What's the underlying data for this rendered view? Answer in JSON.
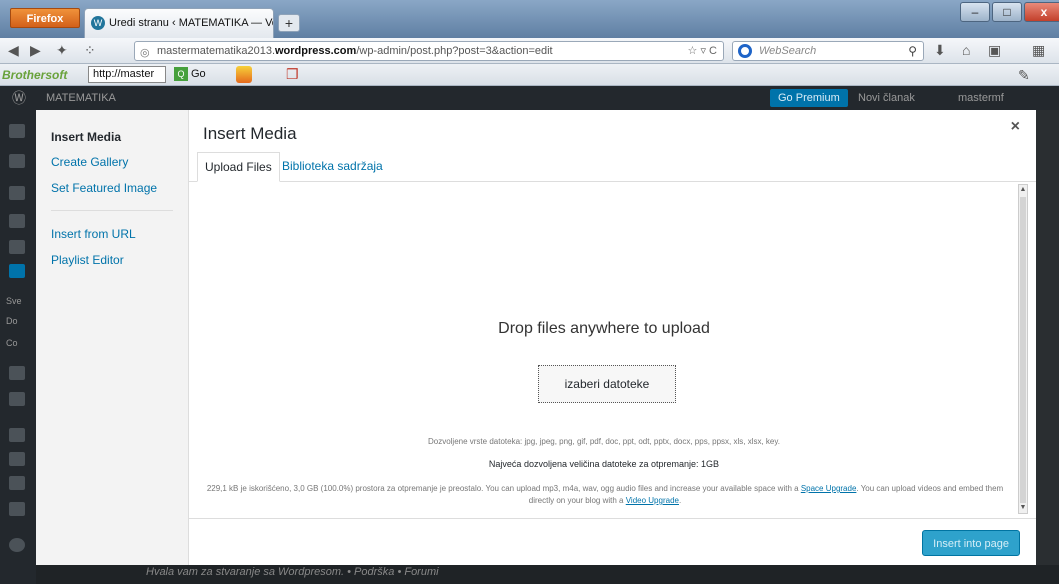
{
  "browser": {
    "app_button": "Firefox",
    "tab_title": "Uredi stranu ‹ MATEMATIKA — Vordpres",
    "new_tab": "+",
    "url_prefix": "mastermatematika2013.",
    "url_domain": "wordpress.com",
    "url_path": "/wp-admin/post.php?post=3&action=edit",
    "search_placeholder": "WebSearch"
  },
  "toolbar_bar": {
    "brand": "Brothersoft",
    "select_value": "http://master",
    "go_label": "Go"
  },
  "wp_admin_bar": {
    "site_name": "MATEMATIKA",
    "go_premium": "Go Premium",
    "new_post": "Novi članak",
    "user": "mastermf"
  },
  "sidebar": {
    "labels": [
      "Sve",
      "Do",
      "Co"
    ]
  },
  "modal": {
    "title": "Insert Media",
    "close": "×",
    "menu": [
      {
        "label": "Insert Media"
      },
      {
        "label": "Create Gallery"
      },
      {
        "label": "Set Featured Image"
      },
      {
        "label": "Insert from URL"
      },
      {
        "label": "Playlist Editor"
      }
    ],
    "tabs": [
      {
        "label": "Upload Files"
      },
      {
        "label": "Biblioteka sadržaja"
      }
    ],
    "upload": {
      "drop_text": "Drop files anywhere to upload",
      "select_button": "izaberi datoteke",
      "allowed_types": "Dozvoljene vrste datoteka: jpg, jpeg, png, gif, pdf, doc, ppt, odt, pptx, docx, pps, ppsx, xls, xlsx, key.",
      "max_size": "Najveća dozvoljena veličina datoteke za otpremanje: 1GB",
      "usage_text": "229,1 kB je iskorišćeno, 3,0 GB (100.0%) prostora za otpremanje je preostalo. You can upload mp3, m4a, wav, ogg audio files and increase your available space with a",
      "space_upgrade": "Space Upgrade",
      "usage_text_2": ". You can upload videos and embed them directly on your blog with a",
      "video_upgrade": "Video Upgrade",
      "usage_end": "."
    },
    "insert_button": "Insert into page"
  },
  "footer": {
    "text": "Hvala vam za stvaranje sa Wordpresom. • Podrška • Forumi"
  }
}
